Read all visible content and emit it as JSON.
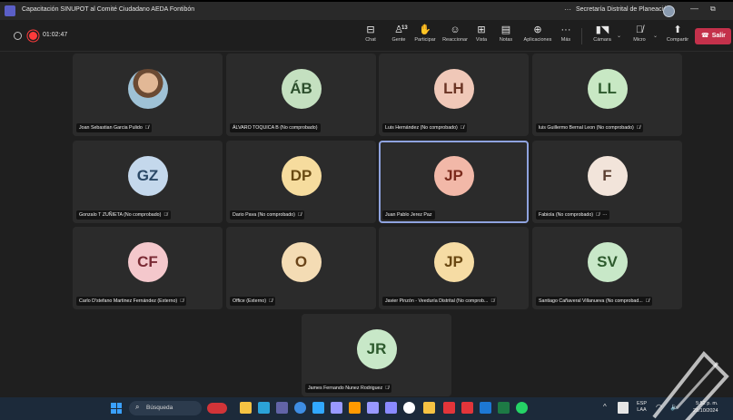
{
  "window": {
    "title": "Capacitación SINUPOT al Comité Ciudadano AEDA Fontibón",
    "more": "···",
    "organization": "Secretaría Distrital de Planeación",
    "minimize": "—",
    "restore": "⧉"
  },
  "meeting": {
    "timer": "01:02:47",
    "toolbar": [
      {
        "id": "chat",
        "icon": "⊟",
        "label": "Chat"
      },
      {
        "id": "people",
        "icon": "♙",
        "count": "13",
        "label": "Gente"
      },
      {
        "id": "raise",
        "icon": "✋",
        "label": "Participar"
      },
      {
        "id": "react",
        "icon": "☺",
        "label": "Reaccionar"
      },
      {
        "id": "view",
        "icon": "⊞",
        "label": "Vista"
      },
      {
        "id": "notes",
        "icon": "▤",
        "label": "Notas"
      },
      {
        "id": "apps",
        "icon": "⊕",
        "label": "Aplicaciones"
      },
      {
        "id": "more",
        "icon": "···",
        "label": "Más"
      }
    ],
    "camera_label": "Cámara",
    "mic_label": "Micro",
    "share_label": "Compartir",
    "leave_label": "Salir"
  },
  "participants": [
    {
      "name": "Joan Sebastian Garcia Pulido",
      "initials": "",
      "photo": true,
      "avatar_bg": "#000000",
      "avatar_fg": "#000000",
      "muted": true
    },
    {
      "name": "ÁLVARO TOQUICA B (No comprobado)",
      "initials": "ÁB",
      "avatar_bg": "#c4e0c0",
      "avatar_fg": "#2d4f2d",
      "muted": false
    },
    {
      "name": "Luis Hernández (No comprobado)",
      "initials": "LH",
      "avatar_bg": "#f0c8b8",
      "avatar_fg": "#6a3424",
      "muted": true
    },
    {
      "name": "luis Guillermo Bernal Leon (No comprobado)",
      "initials": "LL",
      "avatar_bg": "#c8e8c4",
      "avatar_fg": "#2d5a2d",
      "muted": true
    },
    {
      "name": "Gonzalo T ZUÑIETA (No comprobado)",
      "initials": "GZ",
      "avatar_bg": "#c4d8ec",
      "avatar_fg": "#2a4866",
      "muted": true
    },
    {
      "name": "Dario Pava (No comprobado)",
      "initials": "DP",
      "avatar_bg": "#f6dc9e",
      "avatar_fg": "#6a4a12",
      "muted": true
    },
    {
      "name": "Juan Pablo Jerez Paz",
      "initials": "JP",
      "avatar_bg": "#f2b8a8",
      "avatar_fg": "#7a2a1c",
      "muted": false,
      "active": true
    },
    {
      "name": "Fabiola (No comprobado)",
      "initials": "F",
      "avatar_bg": "#f2e4da",
      "avatar_fg": "#5a3e30",
      "muted": true,
      "more": "···"
    },
    {
      "name": "Carlo D'stefano Martinez Fernández (Externo)",
      "initials": "CF",
      "avatar_bg": "#f4c8cc",
      "avatar_fg": "#7a2a34",
      "muted": true
    },
    {
      "name": "Office (Externo)",
      "initials": "O",
      "avatar_bg": "#f4dcb4",
      "avatar_fg": "#6a4418",
      "muted": true
    },
    {
      "name": "Javier Pinzón - Veeduría Distrital (No comprob...",
      "initials": "JP",
      "avatar_bg": "#f6dca4",
      "avatar_fg": "#6a4812",
      "muted": true
    },
    {
      "name": "Santiago Cañaveral Villanueva (No comprobad...",
      "initials": "SV",
      "avatar_bg": "#c8e8c8",
      "avatar_fg": "#2d5a2d",
      "muted": true
    },
    {
      "name": "James Fernando Nunez Rodriguez",
      "initials": "JR",
      "avatar_bg": "#c8e8c8",
      "avatar_fg": "#2d5a2d",
      "muted": true
    }
  ],
  "taskbar": {
    "search_label": "Búsqueda",
    "pinned": [
      {
        "name": "file-explorer",
        "color": "#f6c343"
      },
      {
        "name": "edge",
        "color": "#2ba3d8"
      },
      {
        "name": "teams",
        "color": "#6264a7"
      },
      {
        "name": "chrome",
        "color": "#3e8de3"
      },
      {
        "name": "photoshop",
        "color": "#31a8ff"
      },
      {
        "name": "after-effects",
        "color": "#9999ff"
      },
      {
        "name": "illustrator",
        "color": "#ff9a00"
      },
      {
        "name": "premiere",
        "color": "#9999ff"
      },
      {
        "name": "media-encoder",
        "color": "#8a8aff"
      },
      {
        "name": "obs",
        "color": "#ffffff"
      },
      {
        "name": "folder",
        "color": "#f6c343"
      },
      {
        "name": "app-red",
        "color": "#e2353a"
      },
      {
        "name": "app-red-2",
        "color": "#e2353a"
      },
      {
        "name": "outlook",
        "color": "#1d78d4"
      },
      {
        "name": "excel",
        "color": "#1d7a45"
      },
      {
        "name": "whatsapp",
        "color": "#25d366"
      }
    ],
    "tray_chevron": "^",
    "lang_line1": "ESP",
    "lang_line2": "LAA",
    "time": "5:52 p. m.",
    "date": "21/10/2024"
  }
}
